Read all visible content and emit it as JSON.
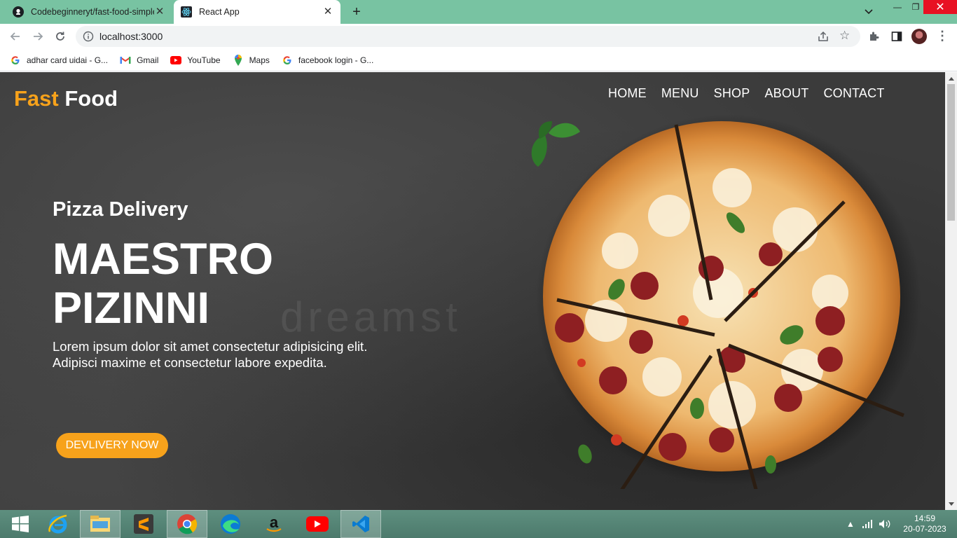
{
  "browser": {
    "tabs": [
      {
        "title": "Codebeginneryt/fast-food-simple",
        "icon": "github-icon",
        "active": false
      },
      {
        "title": "React App",
        "icon": "react-icon",
        "active": true
      }
    ],
    "url": "localhost:3000",
    "bookmarks": [
      {
        "label": "adhar card uidai - G...",
        "icon": "google-icon"
      },
      {
        "label": "Gmail",
        "icon": "gmail-icon"
      },
      {
        "label": "YouTube",
        "icon": "youtube-icon"
      },
      {
        "label": "Maps",
        "icon": "maps-icon"
      },
      {
        "label": "facebook login - G...",
        "icon": "google-icon"
      }
    ]
  },
  "page": {
    "brand": {
      "accent": "Fast",
      "rest": "Food"
    },
    "nav": [
      "HOME",
      "MENU",
      "SHOP",
      "ABOUT",
      "CONTACT"
    ],
    "hero": {
      "subtitle": "Pizza Delivery",
      "title_line1": "MAESTRO",
      "title_line2": "PIZINNI",
      "text": "Lorem ipsum dolor sit amet consectetur adipisicing elit. Adipisci maxime et consectetur labore expedita.",
      "cta": "DEVLIVERY NOW"
    },
    "watermark": "dreamst",
    "colors": {
      "accent": "#f7a21b",
      "background": "#3b3b3b"
    }
  },
  "taskbar": {
    "apps": [
      "windows-start",
      "internet-explorer",
      "file-explorer",
      "sublime-text",
      "chrome",
      "edge",
      "amazon",
      "youtube",
      "vscode"
    ],
    "time": "14:59",
    "date": "20-07-2023"
  }
}
